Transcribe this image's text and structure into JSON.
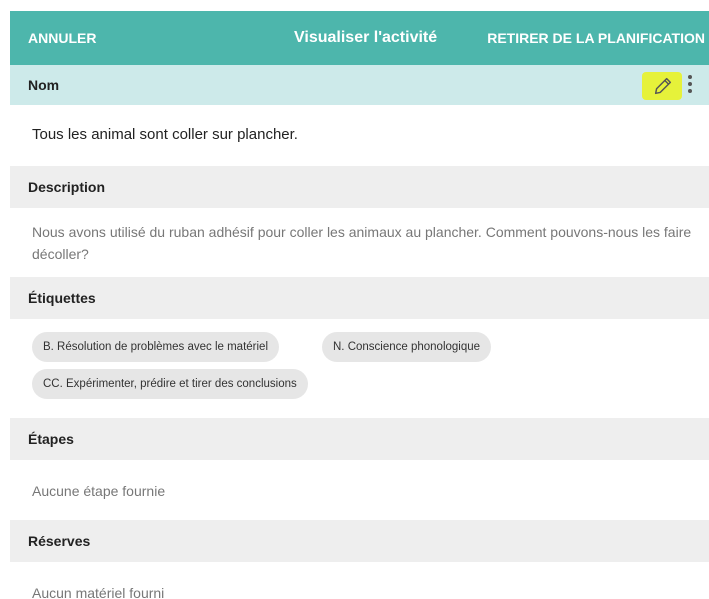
{
  "header": {
    "cancel_label": "ANNULER",
    "title": "Visualiser l'activité",
    "unplan_label": "RETIRER DE LA PLANIFICATION"
  },
  "name_section": {
    "label": "Nom",
    "value": "Tous les animal sont coller sur plancher.",
    "edit_icon": "pencil-icon",
    "more_icon": "more-vert-icon"
  },
  "description_section": {
    "label": "Description",
    "value": "Nous avons utilisé du ruban adhésif pour coller les animaux au plancher. Comment pouvons-nous les faire décoller?"
  },
  "tags_section": {
    "label": "Étiquettes",
    "tags": [
      "B. Résolution de problèmes avec le matériel",
      "N. Conscience phonologique",
      "CC. Expérimenter, prédire et tirer des conclusions"
    ]
  },
  "steps_section": {
    "label": "Étapes",
    "empty_text": "Aucune étape fournie"
  },
  "reserves_section": {
    "label": "Réserves",
    "empty_text": "Aucun matériel fourni"
  },
  "colors": {
    "header_bg": "#4db6ac",
    "name_bar_bg": "#cdeaea",
    "section_bg": "#eeeeee",
    "edit_highlight": "#e6f23a",
    "chip_bg": "#e6e6e6"
  }
}
